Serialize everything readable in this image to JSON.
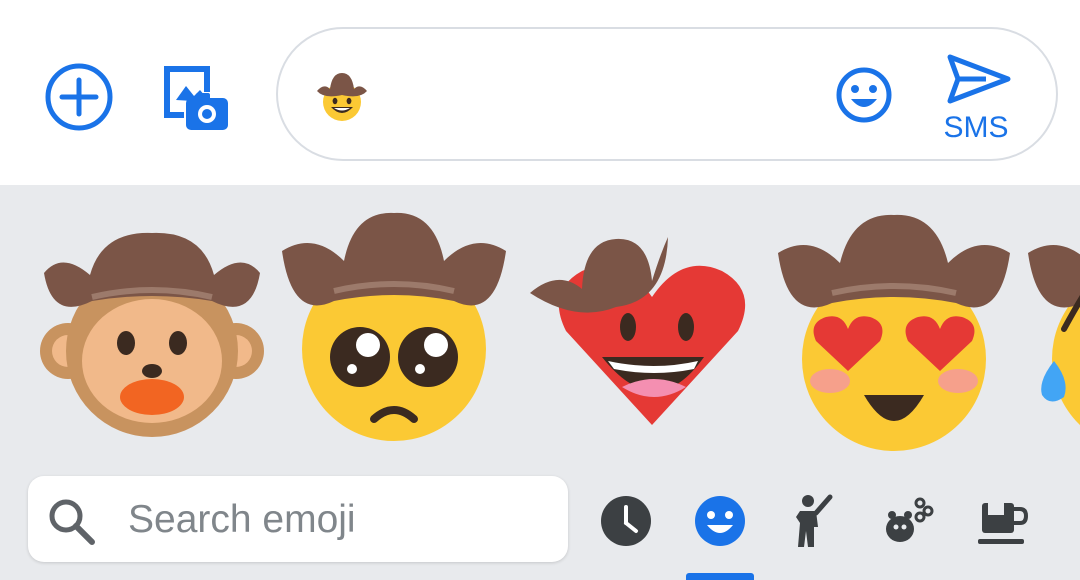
{
  "compose": {
    "add_icon": "add-circle-icon",
    "gallery_icon": "gallery-camera-icon",
    "message_emoji": "cowboy-face-emoji",
    "emoji_button_icon": "smiley-icon",
    "send_icon": "send-icon",
    "send_label": "SMS"
  },
  "keyboard": {
    "stickers": [
      {
        "name": "cowboy-monkey-sticker"
      },
      {
        "name": "cowboy-pleading-face-sticker"
      },
      {
        "name": "cowboy-heart-face-sticker"
      },
      {
        "name": "cowboy-heart-eyes-sticker"
      },
      {
        "name": "cowboy-sweat-face-sticker"
      }
    ],
    "search": {
      "placeholder": "Search emoji"
    },
    "categories": [
      {
        "name": "recent-icon",
        "selected": false
      },
      {
        "name": "smileys-icon",
        "selected": true
      },
      {
        "name": "people-icon",
        "selected": false
      },
      {
        "name": "animals-nature-icon",
        "selected": false
      },
      {
        "name": "food-drink-icon",
        "selected": false
      }
    ]
  },
  "colors": {
    "accent": "#1a73e8",
    "keyboard_bg": "#e8eaed",
    "hat": "#7b5547",
    "face_yellow": "#fbc934"
  }
}
